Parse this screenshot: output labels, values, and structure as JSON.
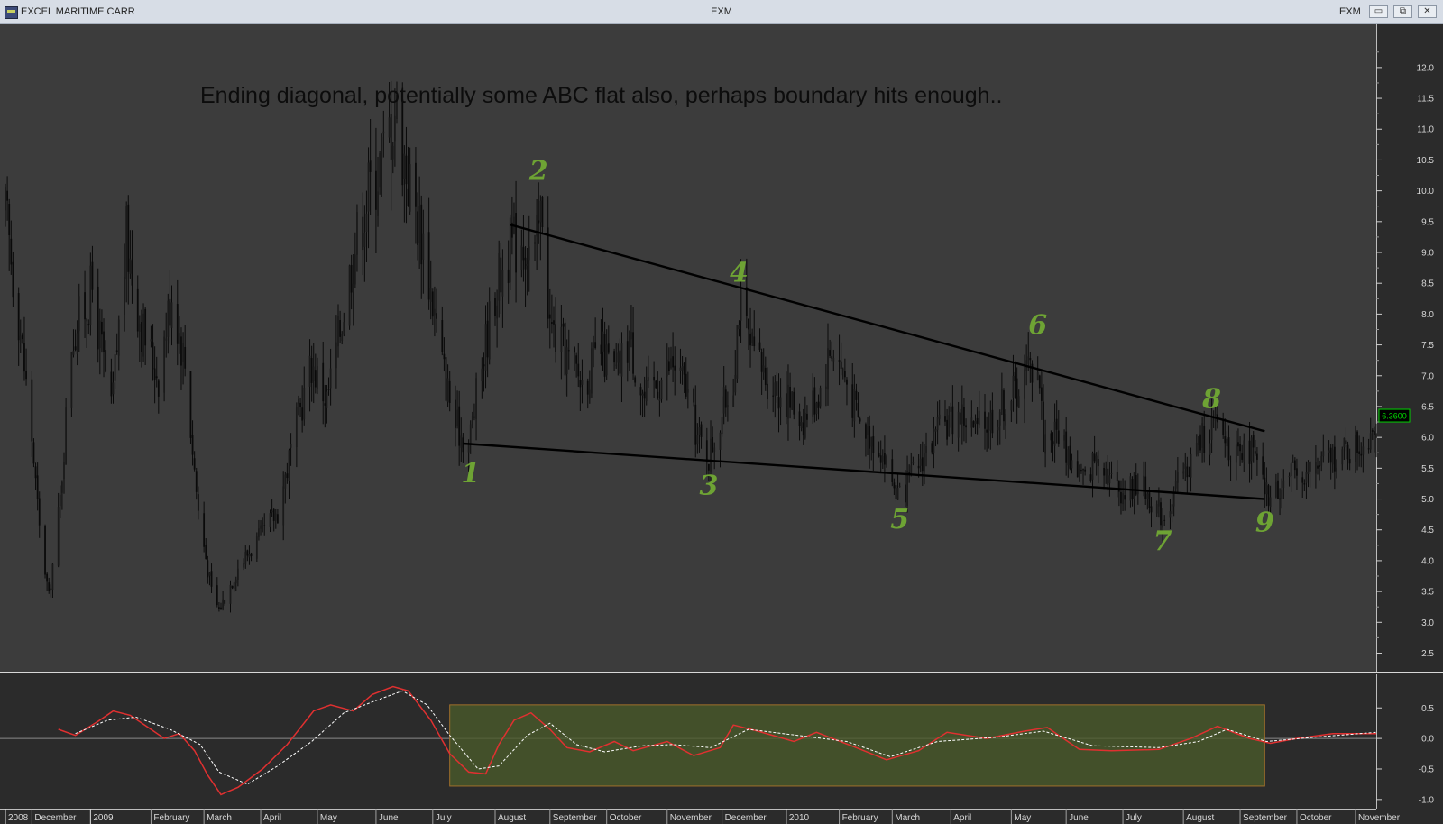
{
  "window": {
    "title": "EXCEL MARITIME CARR",
    "center_title": "EXM",
    "right_title": "EXM",
    "buttons": {
      "minimize": "▭",
      "restore": "⧉",
      "close": "✕"
    }
  },
  "colors": {
    "price_bg": "#3c3c3c",
    "indicator_bg": "#2b2b2b",
    "axis_bg": "#2b2b2b",
    "candle": "#0a0a0a",
    "wave_label": "#6ea334",
    "trendline": "#000000",
    "macd_line": "#e03030",
    "signal_line": "#ffffff",
    "highlight_fill": "#4a5a2a",
    "highlight_border": "#a0702a",
    "price_tag_bg": "#000000",
    "price_tag_border": "#00d000",
    "price_tag_text": "#00e000"
  },
  "chart_data": [
    {
      "type": "candlestick",
      "title": "Ending diagonal, potentially some ABC flat also, perhaps boundary hits enough..",
      "ylim": [
        2.2,
        12.7
      ],
      "y_ticks": [
        2.5,
        3.0,
        3.5,
        4.0,
        4.5,
        5.0,
        5.5,
        6.0,
        6.5,
        7.0,
        7.5,
        8.0,
        8.5,
        9.0,
        9.5,
        10.0,
        10.5,
        11.0,
        11.5,
        12.0
      ],
      "y_tick_labels": [
        "2.5",
        "3.0",
        "3.5",
        "4.0",
        "4.5",
        "5.0",
        "5.5",
        "6.0",
        "6.5",
        "7.0",
        "7.5",
        "8.0",
        "8.5",
        "9.0",
        "9.5",
        "10.0",
        "10.5",
        "11.0",
        "11.5",
        "12.0"
      ],
      "x_start": "2008-11-17",
      "x_end": "2010-11-12",
      "last_price_label": "6.3600",
      "price_path": [
        [
          "2008-11-17",
          9.6
        ],
        [
          "2008-11-24",
          8.0
        ],
        [
          "2008-12-01",
          6.0
        ],
        [
          "2008-12-05",
          4.5
        ],
        [
          "2008-12-10",
          3.4
        ],
        [
          "2008-12-16",
          5.0
        ],
        [
          "2008-12-22",
          7.6
        ],
        [
          "2009-01-02",
          8.4
        ],
        [
          "2009-01-12",
          6.4
        ],
        [
          "2009-01-20",
          9.2
        ],
        [
          "2009-01-28",
          7.8
        ],
        [
          "2009-02-06",
          7.0
        ],
        [
          "2009-02-13",
          8.4
        ],
        [
          "2009-02-20",
          7.2
        ],
        [
          "2009-02-27",
          4.8
        ],
        [
          "2009-03-06",
          3.5
        ],
        [
          "2009-03-10",
          3.2
        ],
        [
          "2009-03-20",
          3.9
        ],
        [
          "2009-04-01",
          4.4
        ],
        [
          "2009-04-10",
          4.8
        ],
        [
          "2009-04-20",
          6.2
        ],
        [
          "2009-04-28",
          7.2
        ],
        [
          "2009-05-06",
          6.6
        ],
        [
          "2009-05-12",
          7.6
        ],
        [
          "2009-05-20",
          9.0
        ],
        [
          "2009-05-28",
          10.0
        ],
        [
          "2009-06-05",
          10.6
        ],
        [
          "2009-06-11",
          11.4
        ],
        [
          "2009-06-18",
          10.2
        ],
        [
          "2009-06-26",
          9.2
        ],
        [
          "2009-07-06",
          7.2
        ],
        [
          "2009-07-13",
          6.2
        ],
        [
          "2009-07-20",
          5.9
        ],
        [
          "2009-07-27",
          7.2
        ],
        [
          "2009-08-03",
          8.4
        ],
        [
          "2009-08-10",
          9.0
        ],
        [
          "2009-08-17",
          9.3
        ],
        [
          "2009-08-24",
          8.9
        ],
        [
          "2009-08-28",
          9.8
        ],
        [
          "2009-09-01",
          7.8
        ],
        [
          "2009-09-10",
          7.3
        ],
        [
          "2009-09-18",
          6.9
        ],
        [
          "2009-09-28",
          7.4
        ],
        [
          "2009-10-06",
          7.0
        ],
        [
          "2009-10-13",
          7.6
        ],
        [
          "2009-10-21",
          6.6
        ],
        [
          "2009-10-28",
          6.9
        ],
        [
          "2009-11-05",
          7.2
        ],
        [
          "2009-11-12",
          6.8
        ],
        [
          "2009-11-18",
          6.0
        ],
        [
          "2009-11-24",
          5.7
        ],
        [
          "2009-12-01",
          6.4
        ],
        [
          "2009-12-07",
          7.0
        ],
        [
          "2009-12-10",
          8.2
        ],
        [
          "2009-12-16",
          7.4
        ],
        [
          "2009-12-24",
          7.0
        ],
        [
          "2010-01-05",
          6.6
        ],
        [
          "2010-01-13",
          6.3
        ],
        [
          "2010-01-22",
          6.8
        ],
        [
          "2010-01-28",
          7.5
        ],
        [
          "2010-02-04",
          7.0
        ],
        [
          "2010-02-12",
          6.2
        ],
        [
          "2010-02-22",
          5.9
        ],
        [
          "2010-03-01",
          5.3
        ],
        [
          "2010-03-05",
          5.0
        ],
        [
          "2010-03-12",
          5.4
        ],
        [
          "2010-03-19",
          5.8
        ],
        [
          "2010-03-29",
          6.2
        ],
        [
          "2010-04-06",
          6.4
        ],
        [
          "2010-04-14",
          6.1
        ],
        [
          "2010-04-22",
          6.3
        ],
        [
          "2010-04-30",
          6.6
        ],
        [
          "2010-05-06",
          6.8
        ],
        [
          "2010-05-12",
          7.1
        ],
        [
          "2010-05-17",
          7.3
        ],
        [
          "2010-05-20",
          6.0
        ],
        [
          "2010-05-28",
          6.1
        ],
        [
          "2010-06-04",
          5.6
        ],
        [
          "2010-06-11",
          5.3
        ],
        [
          "2010-06-18",
          5.8
        ],
        [
          "2010-06-25",
          5.3
        ],
        [
          "2010-07-02",
          5.1
        ],
        [
          "2010-07-09",
          5.3
        ],
        [
          "2010-07-16",
          5.0
        ],
        [
          "2010-07-22",
          4.7
        ],
        [
          "2010-07-28",
          5.1
        ],
        [
          "2010-08-04",
          5.5
        ],
        [
          "2010-08-10",
          5.9
        ],
        [
          "2010-08-17",
          6.2
        ],
        [
          "2010-08-24",
          6.0
        ],
        [
          "2010-08-31",
          5.6
        ],
        [
          "2010-09-07",
          5.8
        ],
        [
          "2010-09-13",
          5.2
        ],
        [
          "2010-09-17",
          5.0
        ],
        [
          "2010-09-24",
          5.3
        ],
        [
          "2010-10-01",
          5.4
        ],
        [
          "2010-10-11",
          5.5
        ],
        [
          "2010-10-20",
          5.7
        ],
        [
          "2010-10-29",
          5.8
        ],
        [
          "2010-11-05",
          5.9
        ],
        [
          "2010-11-12",
          6.36
        ]
      ],
      "trendlines": [
        {
          "name": "upper",
          "points": [
            [
              "2009-08-11",
              9.45
            ],
            [
              "2010-09-14",
              6.1
            ]
          ]
        },
        {
          "name": "lower",
          "points": [
            [
              "2009-07-17",
              5.9
            ],
            [
              "2010-09-14",
              5.0
            ]
          ]
        }
      ],
      "wave_labels": [
        {
          "label": "1",
          "x": "2009-07-21",
          "y": 5.8,
          "place": "below"
        },
        {
          "label": "2",
          "x": "2009-08-26",
          "y": 10.0,
          "place": "above"
        },
        {
          "label": "3",
          "x": "2009-11-24",
          "y": 5.6,
          "place": "below"
        },
        {
          "label": "4",
          "x": "2009-12-10",
          "y": 8.35,
          "place": "above"
        },
        {
          "label": "5",
          "x": "2010-03-05",
          "y": 5.05,
          "place": "below"
        },
        {
          "label": "6",
          "x": "2010-05-17",
          "y": 7.5,
          "place": "above"
        },
        {
          "label": "7",
          "x": "2010-07-22",
          "y": 4.7,
          "place": "below"
        },
        {
          "label": "8",
          "x": "2010-08-17",
          "y": 6.3,
          "place": "above"
        },
        {
          "label": "9",
          "x": "2010-09-14",
          "y": 5.0,
          "place": "below"
        }
      ]
    },
    {
      "type": "line",
      "ylim": [
        -1.15,
        1.05
      ],
      "y_ticks": [
        -1.0,
        -0.5,
        0.0,
        0.5
      ],
      "y_tick_labels": [
        "-1.0",
        "-0.5",
        "0.0",
        "0.5"
      ],
      "zero_line": 0.0,
      "highlight": {
        "x0": "2009-07-10",
        "x1": "2010-09-14",
        "y0": -0.78,
        "y1": 0.55
      },
      "series": [
        {
          "style": "solid",
          "points": [
            [
              "2008-12-15",
              0.15
            ],
            [
              "2008-12-24",
              0.05
            ],
            [
              "2009-01-05",
              0.28
            ],
            [
              "2009-01-13",
              0.45
            ],
            [
              "2009-01-22",
              0.38
            ],
            [
              "2009-02-02",
              0.15
            ],
            [
              "2009-02-09",
              0.0
            ],
            [
              "2009-02-17",
              0.08
            ],
            [
              "2009-02-25",
              -0.2
            ],
            [
              "2009-03-04",
              -0.6
            ],
            [
              "2009-03-11",
              -0.92
            ],
            [
              "2009-03-20",
              -0.8
            ],
            [
              "2009-04-02",
              -0.5
            ],
            [
              "2009-04-15",
              -0.1
            ],
            [
              "2009-04-29",
              0.45
            ],
            [
              "2009-05-08",
              0.55
            ],
            [
              "2009-05-20",
              0.45
            ],
            [
              "2009-05-30",
              0.72
            ],
            [
              "2009-06-10",
              0.85
            ],
            [
              "2009-06-18",
              0.78
            ],
            [
              "2009-06-30",
              0.3
            ],
            [
              "2009-07-10",
              -0.25
            ],
            [
              "2009-07-20",
              -0.55
            ],
            [
              "2009-07-29",
              -0.58
            ],
            [
              "2009-08-05",
              -0.1
            ],
            [
              "2009-08-13",
              0.3
            ],
            [
              "2009-08-22",
              0.42
            ],
            [
              "2009-09-01",
              0.15
            ],
            [
              "2009-09-10",
              -0.15
            ],
            [
              "2009-09-22",
              -0.22
            ],
            [
              "2009-10-05",
              -0.05
            ],
            [
              "2009-10-15",
              -0.2
            ],
            [
              "2009-11-02",
              -0.05
            ],
            [
              "2009-11-16",
              -0.28
            ],
            [
              "2009-11-30",
              -0.15
            ],
            [
              "2009-12-07",
              0.22
            ],
            [
              "2009-12-20",
              0.12
            ],
            [
              "2010-01-08",
              -0.05
            ],
            [
              "2010-01-20",
              0.1
            ],
            [
              "2010-02-10",
              -0.15
            ],
            [
              "2010-02-26",
              -0.35
            ],
            [
              "2010-03-15",
              -0.2
            ],
            [
              "2010-03-30",
              0.1
            ],
            [
              "2010-04-20",
              0.0
            ],
            [
              "2010-05-10",
              0.12
            ],
            [
              "2010-05-22",
              0.18
            ],
            [
              "2010-06-08",
              -0.18
            ],
            [
              "2010-06-25",
              -0.2
            ],
            [
              "2010-07-20",
              -0.18
            ],
            [
              "2010-08-06",
              0.0
            ],
            [
              "2010-08-20",
              0.2
            ],
            [
              "2010-09-06",
              0.0
            ],
            [
              "2010-09-17",
              -0.08
            ],
            [
              "2010-10-01",
              0.0
            ],
            [
              "2010-10-20",
              0.08
            ],
            [
              "2010-11-12",
              0.08
            ]
          ]
        },
        {
          "style": "dashed",
          "points": [
            [
              "2008-12-24",
              0.08
            ],
            [
              "2009-01-10",
              0.3
            ],
            [
              "2009-01-25",
              0.35
            ],
            [
              "2009-02-12",
              0.15
            ],
            [
              "2009-02-28",
              -0.1
            ],
            [
              "2009-03-10",
              -0.55
            ],
            [
              "2009-03-25",
              -0.75
            ],
            [
              "2009-04-10",
              -0.45
            ],
            [
              "2009-04-28",
              -0.05
            ],
            [
              "2009-05-15",
              0.42
            ],
            [
              "2009-06-01",
              0.62
            ],
            [
              "2009-06-15",
              0.78
            ],
            [
              "2009-06-28",
              0.55
            ],
            [
              "2009-07-10",
              0.05
            ],
            [
              "2009-07-25",
              -0.5
            ],
            [
              "2009-08-05",
              -0.45
            ],
            [
              "2009-08-20",
              0.05
            ],
            [
              "2009-09-01",
              0.25
            ],
            [
              "2009-09-15",
              -0.1
            ],
            [
              "2009-09-30",
              -0.22
            ],
            [
              "2009-10-20",
              -0.12
            ],
            [
              "2009-11-05",
              -0.1
            ],
            [
              "2009-11-25",
              -0.15
            ],
            [
              "2009-12-15",
              0.15
            ],
            [
              "2010-01-10",
              0.05
            ],
            [
              "2010-02-05",
              -0.05
            ],
            [
              "2010-02-28",
              -0.3
            ],
            [
              "2010-03-25",
              -0.05
            ],
            [
              "2010-04-25",
              0.02
            ],
            [
              "2010-05-20",
              0.12
            ],
            [
              "2010-06-15",
              -0.12
            ],
            [
              "2010-07-20",
              -0.15
            ],
            [
              "2010-08-10",
              -0.05
            ],
            [
              "2010-08-25",
              0.15
            ],
            [
              "2010-09-15",
              -0.05
            ],
            [
              "2010-10-10",
              0.02
            ],
            [
              "2010-11-12",
              0.1
            ]
          ]
        }
      ]
    }
  ],
  "x_axis": {
    "labels": [
      {
        "text": "2008",
        "date": "2008-11-15",
        "major": true
      },
      {
        "text": "December",
        "date": "2008-12-01"
      },
      {
        "text": "2009",
        "date": "2009-01-01",
        "major": true
      },
      {
        "text": "February",
        "date": "2009-02-02"
      },
      {
        "text": "March",
        "date": "2009-03-02"
      },
      {
        "text": "April",
        "date": "2009-04-01"
      },
      {
        "text": "May",
        "date": "2009-05-01"
      },
      {
        "text": "June",
        "date": "2009-06-01"
      },
      {
        "text": "July",
        "date": "2009-07-01"
      },
      {
        "text": "August",
        "date": "2009-08-03"
      },
      {
        "text": "September",
        "date": "2009-09-01"
      },
      {
        "text": "October",
        "date": "2009-10-01"
      },
      {
        "text": "November",
        "date": "2009-11-02"
      },
      {
        "text": "December",
        "date": "2009-12-01"
      },
      {
        "text": "2010",
        "date": "2010-01-04",
        "major": true
      },
      {
        "text": "February",
        "date": "2010-02-01"
      },
      {
        "text": "March",
        "date": "2010-03-01"
      },
      {
        "text": "April",
        "date": "2010-04-01"
      },
      {
        "text": "May",
        "date": "2010-05-03"
      },
      {
        "text": "June",
        "date": "2010-06-01"
      },
      {
        "text": "July",
        "date": "2010-07-01"
      },
      {
        "text": "August",
        "date": "2010-08-02"
      },
      {
        "text": "September",
        "date": "2010-09-01"
      },
      {
        "text": "October",
        "date": "2010-10-01"
      },
      {
        "text": "November",
        "date": "2010-11-01"
      }
    ]
  }
}
